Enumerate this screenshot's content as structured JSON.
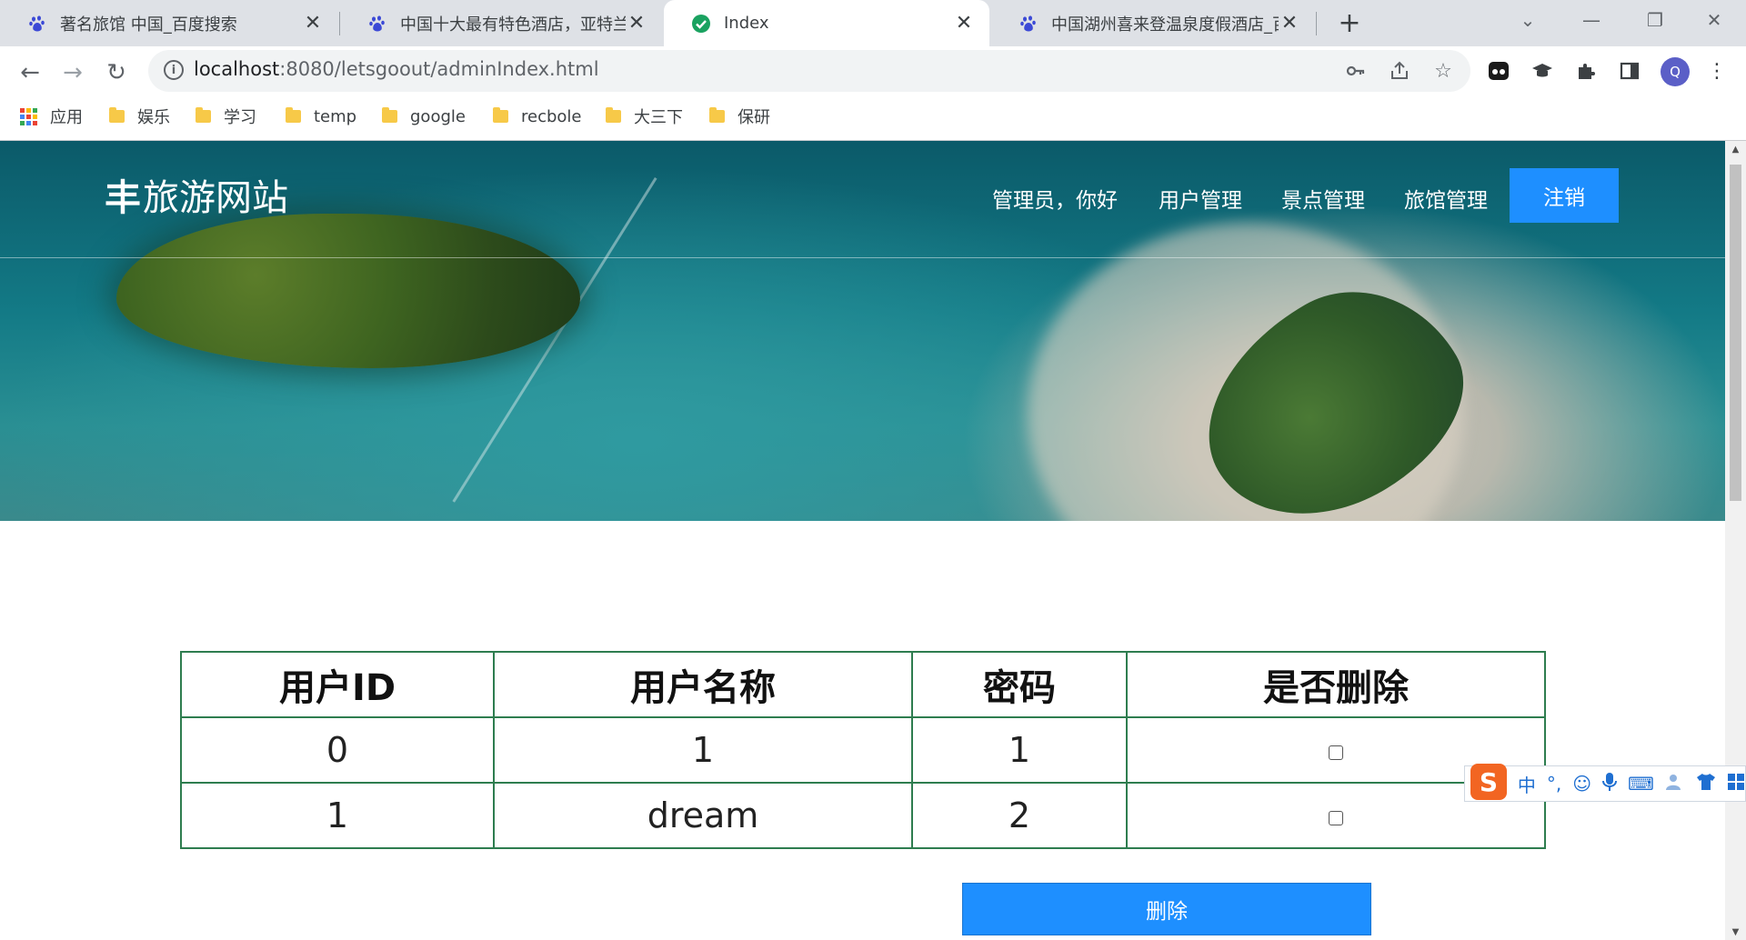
{
  "browser": {
    "tabs": [
      {
        "title": "著名旅馆 中国_百度搜索",
        "favicon": "baidu-paw-icon",
        "active": false
      },
      {
        "title": "中国十大最有特色酒店，亚特兰蒂",
        "favicon": "baidu-paw-icon",
        "active": false
      },
      {
        "title": "Index",
        "favicon": "check-circle-icon",
        "active": true
      },
      {
        "title": "中国湖州喜来登温泉度假酒店_百",
        "favicon": "baidu-paw-icon",
        "active": false
      }
    ],
    "url_host": "localhost",
    "url_rest": ":8080/letsgoout/adminIndex.html",
    "profile_initial": "Q",
    "bookmarks": [
      {
        "label": "应用",
        "icon": "apps-grid-icon"
      },
      {
        "label": "娱乐",
        "icon": "folder-icon"
      },
      {
        "label": "学习",
        "icon": "folder-icon"
      },
      {
        "label": "temp",
        "icon": "folder-icon"
      },
      {
        "label": "google",
        "icon": "folder-icon"
      },
      {
        "label": "recbole",
        "icon": "folder-icon"
      },
      {
        "label": "大三下",
        "icon": "folder-icon"
      },
      {
        "label": "保研",
        "icon": "folder-icon"
      }
    ]
  },
  "site": {
    "logo_mark": "丰",
    "logo_text": "旅游网站",
    "nav": {
      "greeting": "管理员，你好",
      "users": "用户管理",
      "attractions": "景点管理",
      "hotels": "旅馆管理",
      "logout": "注销"
    }
  },
  "table": {
    "headers": [
      "用户ID",
      "用户名称",
      "密码",
      "是否删除"
    ],
    "rows": [
      {
        "id": "0",
        "name": "1",
        "password": "1",
        "delete_checked": false
      },
      {
        "id": "1",
        "name": "dream",
        "password": "2",
        "delete_checked": false
      }
    ]
  },
  "actions": {
    "delete_label": "删除"
  },
  "ime": {
    "logo": "S",
    "mode": "中",
    "punct": "°,"
  },
  "colors": {
    "primary_button": "#1e8fff",
    "table_border": "#2e7d4f"
  }
}
